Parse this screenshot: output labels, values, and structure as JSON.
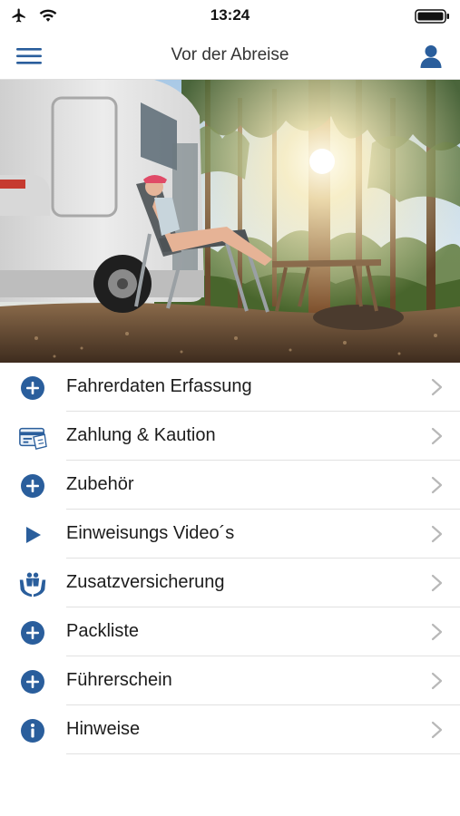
{
  "status_bar": {
    "time": "13:24"
  },
  "nav": {
    "title": "Vor der Abreise"
  },
  "menu": {
    "items": [
      {
        "label": "Fahrerdaten Erfassung",
        "icon": "plus-circle-icon"
      },
      {
        "label": "Zahlung & Kaution",
        "icon": "payment-card-icon"
      },
      {
        "label": "Zubehör",
        "icon": "plus-circle-icon"
      },
      {
        "label": "Einweisungs Video´s",
        "icon": "play-icon"
      },
      {
        "label": "Zusatzversicherung",
        "icon": "insurance-hands-icon"
      },
      {
        "label": "Packliste",
        "icon": "plus-circle-icon"
      },
      {
        "label": "Führerschein",
        "icon": "plus-circle-icon"
      },
      {
        "label": "Hinweise",
        "icon": "info-icon"
      }
    ]
  },
  "colors": {
    "accent": "#2a5e9c",
    "separator": "#e1e1e1",
    "chevron": "#b8b8b8"
  }
}
